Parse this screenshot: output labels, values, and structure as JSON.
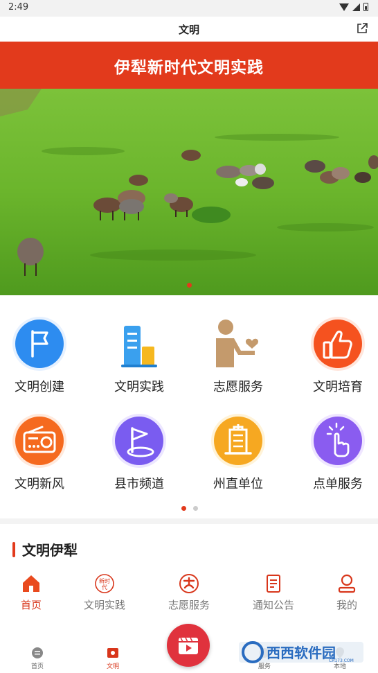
{
  "status": {
    "time": "2:49"
  },
  "header": {
    "title": "文明"
  },
  "banner": {
    "title": "伊犁新时代文明实践"
  },
  "grid": [
    {
      "label": "文明创建",
      "icon": "flag-icon",
      "color": "#2d8cf0"
    },
    {
      "label": "文明实践",
      "icon": "building-chart-icon",
      "color": "#3aa0ee"
    },
    {
      "label": "志愿服务",
      "icon": "volunteer-heart-icon",
      "color": "#c49a6c"
    },
    {
      "label": "文明培育",
      "icon": "thumbs-up-icon",
      "color": "#f5521f"
    },
    {
      "label": "文明新风",
      "icon": "radio-icon",
      "color": "#f56a1f"
    },
    {
      "label": "县市频道",
      "icon": "map-flag-icon",
      "color": "#7a5cf0"
    },
    {
      "label": "州直单位",
      "icon": "office-building-icon",
      "color": "#f6a821"
    },
    {
      "label": "点单服务",
      "icon": "tap-hand-icon",
      "color": "#8a5cf0"
    }
  ],
  "section": {
    "title": "文明伊犁"
  },
  "tabs": [
    {
      "label": "首页",
      "icon": "home-icon",
      "active": true
    },
    {
      "label": "文明实践",
      "icon": "new-era-icon",
      "active": false
    },
    {
      "label": "志愿服务",
      "icon": "volunteer-icon",
      "active": false
    },
    {
      "label": "通知公告",
      "icon": "notice-icon",
      "active": false
    },
    {
      "label": "我的",
      "icon": "user-icon",
      "active": false
    }
  ],
  "bottom_nav": [
    {
      "label": "首页",
      "icon": "home-icon",
      "active": false
    },
    {
      "label": "文明",
      "icon": "civilization-icon",
      "active": true
    },
    {
      "label": "服务",
      "icon": "service-icon",
      "active": false
    },
    {
      "label": "本地",
      "icon": "local-icon",
      "active": false
    }
  ],
  "watermark": {
    "text": "西西软件园",
    "sub": "CR173.COM"
  },
  "colors": {
    "accent": "#e23a1c",
    "active_text": "#d8361b"
  }
}
